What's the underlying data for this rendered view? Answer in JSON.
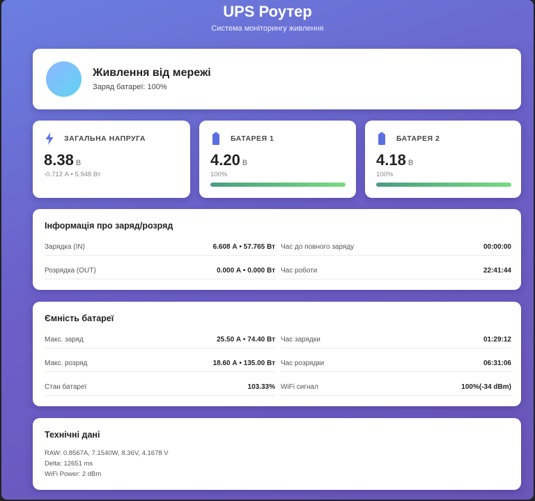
{
  "header": {
    "title": "UPS Роутер",
    "subtitle": "Система моніторингу живлення"
  },
  "status": {
    "title": "Живлення від мережі",
    "battery_text": "Заряд батареї: 100%"
  },
  "metrics": [
    {
      "icon": "lightning-icon",
      "label": "ЗАГАЛЬНА НАПРУГА",
      "value": "8.38",
      "unit": "В",
      "sub": "-0.712 А • 5.948 Вт"
    },
    {
      "icon": "battery-icon",
      "label": "БАТАРЕЯ 1",
      "value": "4.20",
      "unit": "В",
      "sub": "100%",
      "level": 100
    },
    {
      "icon": "battery-icon",
      "label": "БАТАРЕЯ 2",
      "value": "4.18",
      "unit": "В",
      "sub": "100%",
      "level": 100
    }
  ],
  "charge_info": {
    "title": "Інформація про заряд/розряд",
    "left": [
      {
        "label": "Зарядка (IN)",
        "value": "6.608 А • 57.765 Вт"
      },
      {
        "label": "Розрядка (OUT)",
        "value": "0.000 А • 0.000 Вт"
      }
    ],
    "right": [
      {
        "label": "Час до повного заряду",
        "value": "00:00:00"
      },
      {
        "label": "Час роботи",
        "value": "22:41:44"
      }
    ]
  },
  "capacity": {
    "title": "Ємність батареї",
    "left": [
      {
        "label": "Макс. заряд",
        "value": "25.50 А • 74.40 Вт"
      },
      {
        "label": "Макс. розряд",
        "value": "18.60 А • 135.00 Вт"
      },
      {
        "label": "Стан батареї",
        "value": "103.33%"
      }
    ],
    "right": [
      {
        "label": "Час зарядки",
        "value": "01:29:12"
      },
      {
        "label": "Час розрядки",
        "value": "06:31:06"
      },
      {
        "label": "WiFi сигнал",
        "value": "100%(-34 dBm)"
      }
    ]
  },
  "tech": {
    "title": "Технічні дані",
    "lines": [
      "RAW: 0.8567A, 7.1540W, 8.36V, 4.1678 V",
      "Delta: 12651 ms",
      "WiFi Power: 2 dBm"
    ]
  },
  "colors": {
    "accent": "#6b68d0",
    "icon_blue": "#5b6fe0",
    "bar_start": "#4a9d82",
    "bar_end": "#78dc7f"
  }
}
